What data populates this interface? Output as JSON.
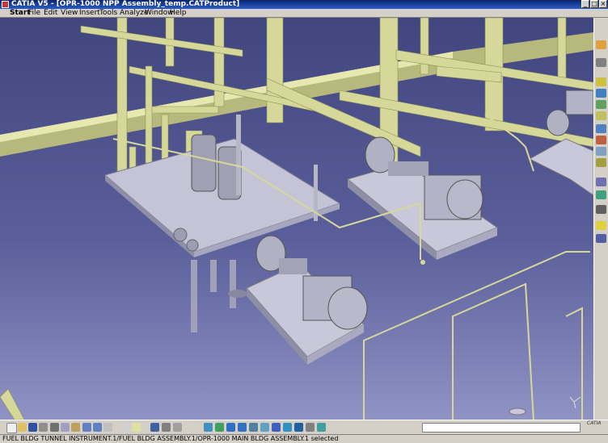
{
  "window": {
    "title": "CATIA V5 - [OPR-1000 NPP Assembly_temp.CATProduct]"
  },
  "menu": [
    {
      "label": "Start"
    },
    {
      "label": "File"
    },
    {
      "label": "Edit"
    },
    {
      "label": "View"
    },
    {
      "label": "Insert"
    },
    {
      "label": "Tools"
    },
    {
      "label": "Analyze"
    },
    {
      "label": "Window"
    },
    {
      "label": "Help"
    }
  ],
  "colors": {
    "pipe": "#d6d89a",
    "pipe_dark": "#9ea064",
    "equipment": "#c8c8d8",
    "background_top": "#41467f",
    "background_bottom": "#8f93c4"
  },
  "viewport": {
    "description_icon": "3d-model-viewport"
  },
  "toolbar": {
    "right_icons": [
      "sketcher-icon",
      "part-design-icon",
      "assembly-icon",
      "constraint-icon",
      "measure-icon",
      "section-icon",
      "clash-icon",
      "manipulate-icon",
      "snap-icon",
      "explode-icon",
      "product-icon",
      "catalog-icon",
      "bolt-icon",
      "light-icon",
      "view-icon"
    ],
    "bottom_icons": [
      "new-icon",
      "open-icon",
      "save-icon",
      "print-icon",
      "cut-icon",
      "copy-icon",
      "paste-icon",
      "undo-icon",
      "redo-icon",
      "help-icon",
      "formula-icon",
      "comment-icon",
      "catalog-icon",
      "analysis-icon",
      "fly-icon",
      "pan-icon",
      "rotate-icon",
      "zoom-in-icon",
      "zoom-out-icon",
      "normal-view-icon",
      "iso-view-icon",
      "shading-icon",
      "hide-show-icon",
      "swap-icon",
      "properties-icon",
      "select-icon"
    ],
    "command_input": ""
  },
  "status": {
    "text": "FUEL BLDG TUNNEL INSTRUMENT.1/FUEL BLDG ASSEMBLY.1/OPR-1000 MAIN BLDG ASSEMBLY.1 selected"
  },
  "logo": {
    "label": "CATIA"
  }
}
